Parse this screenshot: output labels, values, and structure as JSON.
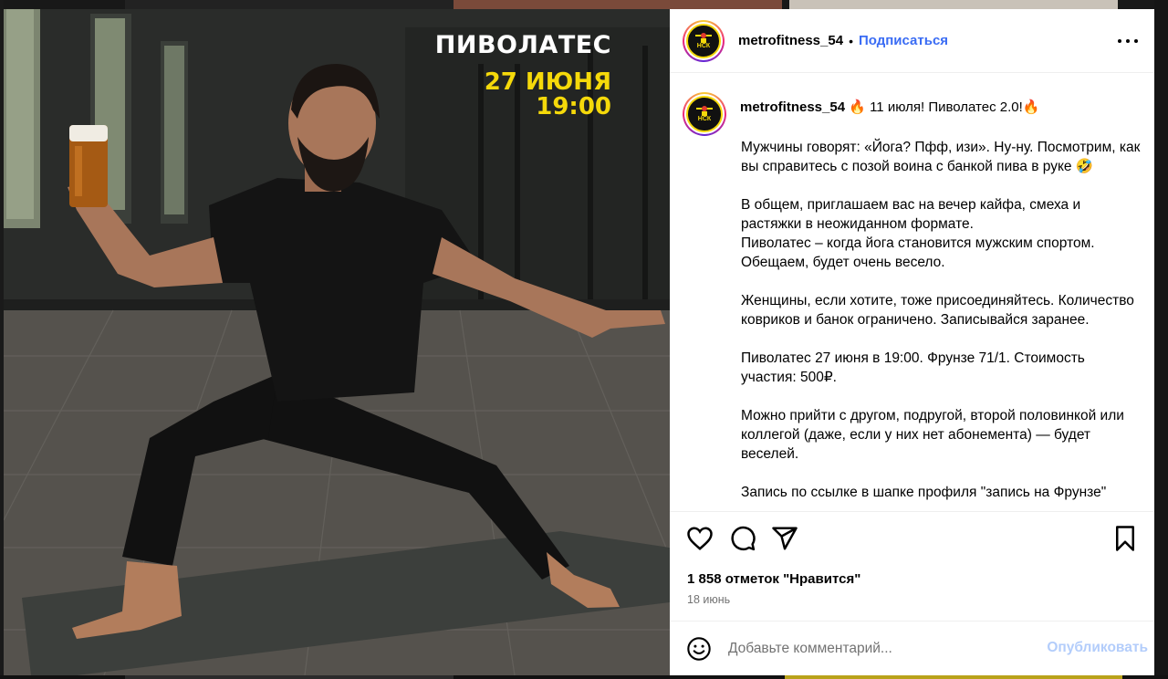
{
  "post": {
    "username": "metrofitness_54",
    "separator": "•",
    "follow_label": "Подписаться",
    "avatar_text": "НСК"
  },
  "poster": {
    "title": "ПИВОЛАТЕС",
    "date": "27 ИЮНЯ",
    "time": "19:00"
  },
  "caption": {
    "username": "metrofitness_54",
    "headline": " 🔥 11 июля! Пиволатес 2.0!🔥",
    "paragraphs": [
      "Мужчины говорят: «Йога? Пфф, изи». Ну-ну. Посмотрим, как вы справитесь с позой воина с банкой пива в руке 🤣",
      "В общем, приглашаем вас на вечер кайфа, смеха и растяжки в неожиданном формате.",
      "Пиволатес – когда йога становится мужским спортом. Обещаем, будет очень весело.",
      "Женщины, если хотите, тоже присоединяйтесь. Количество ковриков и банок ограничено. Записывайся заранее.",
      "Пиволатес 27 июня в 19:00. Фрунзе 71/1. Стоимость участия: 500₽.",
      "Можно прийти с другом, подругой, второй половинкой или коллегой (даже, если у них нет абонемента) — будет веселей.",
      "Запись по ссылке в шапке профиля \"запись на Фрунзе\""
    ]
  },
  "stats": {
    "likes": "1 858 отметок \"Нравится\"",
    "date": "18 июнь"
  },
  "comment": {
    "placeholder": "Добавьте комментарий...",
    "publish_label": "Опубликовать"
  },
  "colors": {
    "accent": "#3a6cf4",
    "publish_disabled": "#b3cdfb",
    "poster_yellow": "#f5d90a"
  },
  "icons": [
    "more-icon",
    "heart-icon",
    "comment-icon",
    "share-icon",
    "bookmark-icon",
    "emoji-icon"
  ]
}
